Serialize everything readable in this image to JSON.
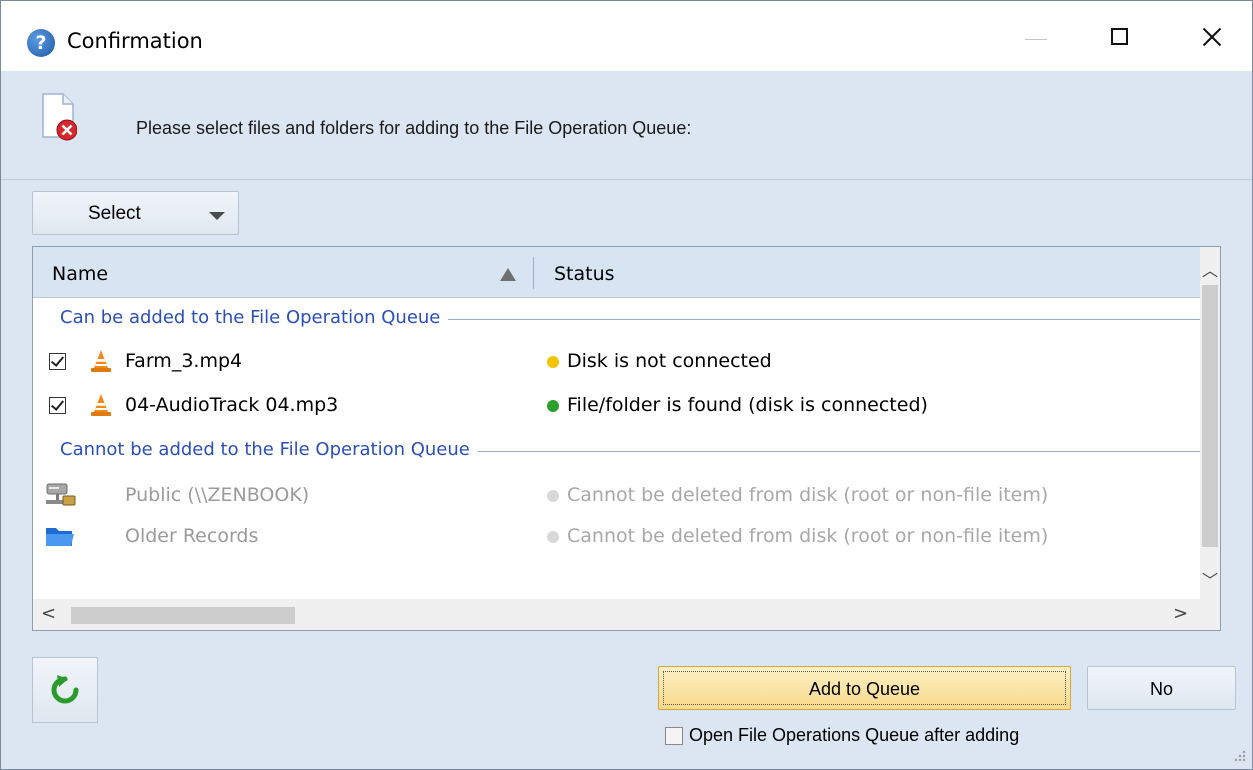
{
  "window": {
    "title": "Confirmation"
  },
  "header": {
    "message": "Please select files and folders for adding to the File Operation Queue:"
  },
  "toolbar": {
    "select_label": "Select"
  },
  "list": {
    "columns": {
      "name": "Name",
      "status": "Status"
    },
    "groups": [
      {
        "label": "Can be added to the File Operation Queue",
        "items": [
          {
            "name": "Farm_3.mp4",
            "checked": true,
            "status": "Disk is not connected",
            "status_color": "#f5c400",
            "icon": "vlc-cone-icon"
          },
          {
            "name": "04-AudioTrack 04.mp3",
            "checked": true,
            "status": "File/folder is found (disk is connected)",
            "status_color": "#2ca02c",
            "icon": "vlc-cone-icon"
          }
        ]
      },
      {
        "label": "Cannot be added to the File Operation Queue",
        "items": [
          {
            "name": "Public (\\\\ZENBOOK)",
            "status": "Cannot be deleted from disk (root or non-file item)",
            "status_color": "#d8d8d8",
            "icon": "network-server-icon"
          },
          {
            "name": "Older Records",
            "status": "Cannot be deleted from disk (root or non-file item)",
            "status_color": "#d8d8d8",
            "icon": "folder-icon"
          }
        ]
      }
    ]
  },
  "footer": {
    "add_label": "Add to Queue",
    "no_label": "No",
    "open_queue_label": "Open File Operations Queue after adding",
    "open_queue_checked": false
  },
  "colors": {
    "accent_group_text": "#2b4fb8",
    "primary_button": "#f8d98a",
    "background": "#dce6f2"
  }
}
